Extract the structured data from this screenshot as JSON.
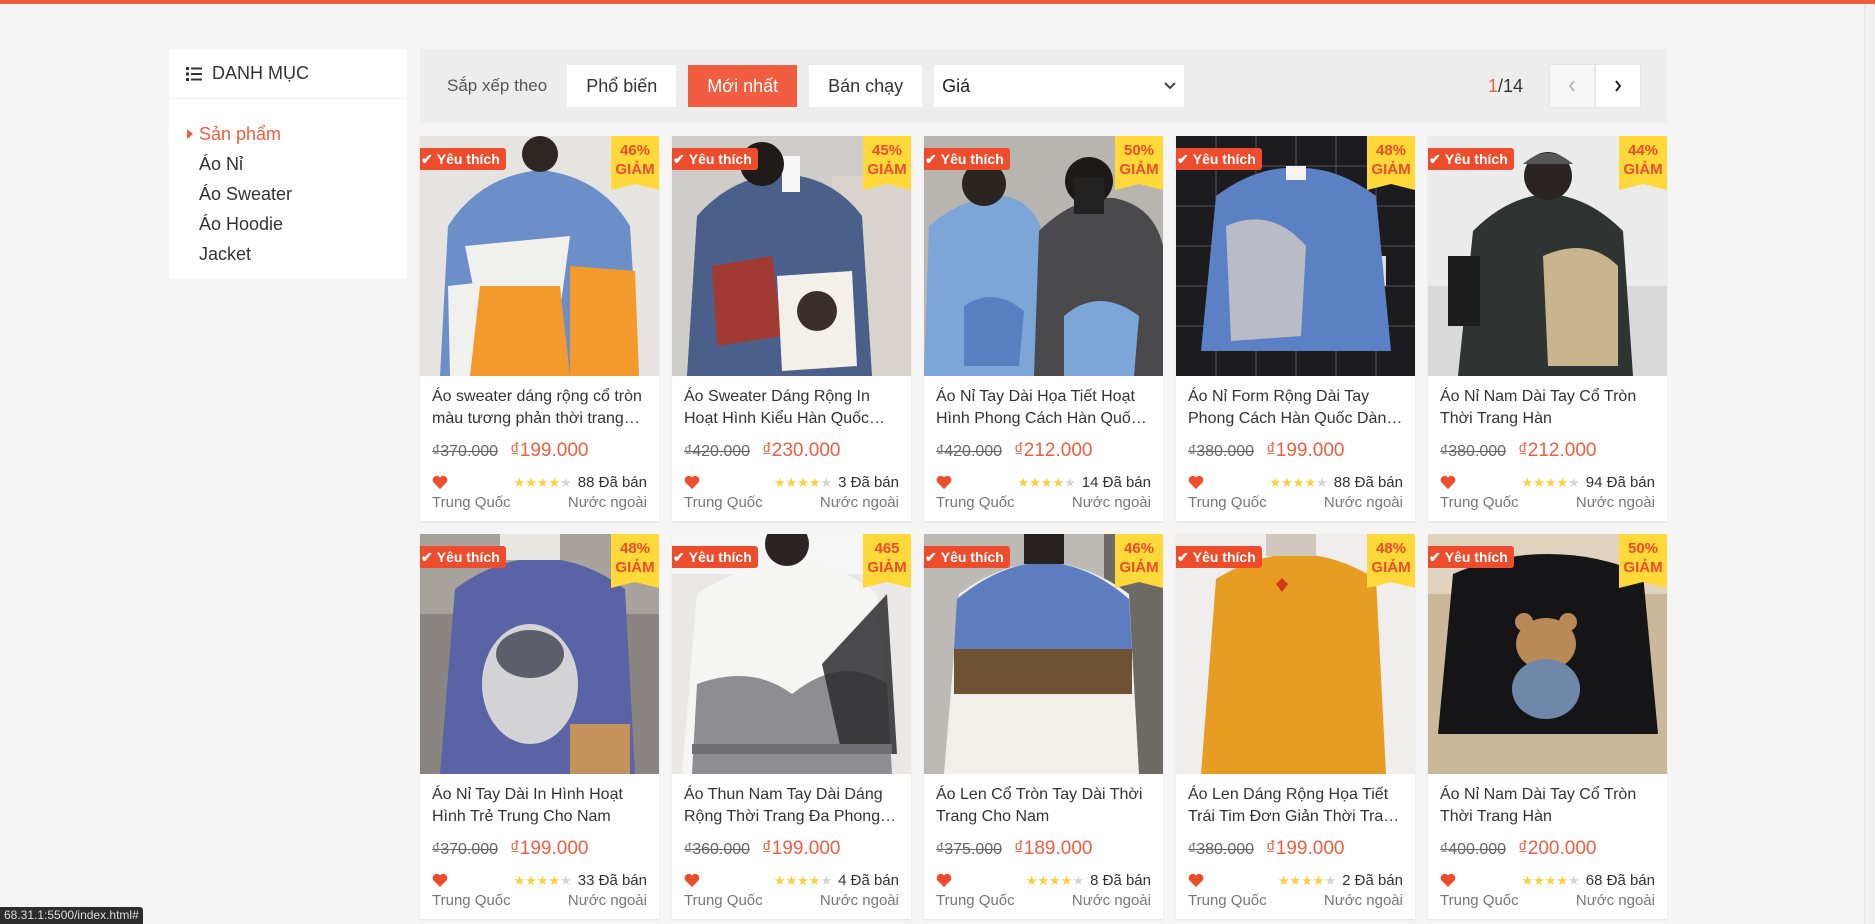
{
  "colors": {
    "accent": "#f05d40",
    "sale_bg": "#ffd839",
    "heart": "#ee4d2d",
    "star": "#ffce3d"
  },
  "category": {
    "icon": "list-icon",
    "title": "DANH MỤC",
    "items": [
      {
        "label": "Sản phẩm",
        "active": true
      },
      {
        "label": "Áo Nỉ",
        "active": false
      },
      {
        "label": "Áo Sweater",
        "active": false
      },
      {
        "label": "Áo Hoodie",
        "active": false
      },
      {
        "label": "Jacket",
        "active": false
      }
    ]
  },
  "sortbar": {
    "label": "Sắp xếp theo",
    "buttons": [
      {
        "label": "Phổ biến",
        "primary": false
      },
      {
        "label": "Mới nhất",
        "primary": true
      },
      {
        "label": "Bán chạy",
        "primary": false
      }
    ],
    "price_select": "Giá",
    "pager": {
      "current": "1",
      "total": "/14"
    }
  },
  "products": [
    {
      "name": "Áo sweater dáng rộng cổ tròn màu tương phản thời trang Hàn Quốc",
      "fav": "Yêu thích",
      "sale_pct": "46%",
      "sale_word": "GIẢM",
      "old_price": "₫370.000",
      "new_price": "₫199.000",
      "rating": 4,
      "sold": "88 Đã bán",
      "brand": "Trung Quốc",
      "origin": "Nước ngoài"
    },
    {
      "name": "Áo Sweater Dáng Rộng In Hoạt Hình Kiểu Hàn Quốc Cho Nam",
      "fav": "Yêu thích",
      "sale_pct": "45%",
      "sale_word": "GIẢM",
      "old_price": "₫420.000",
      "new_price": "₫230.000",
      "rating": 4,
      "sold": "3 Đã bán",
      "brand": "Trung Quốc",
      "origin": "Nước ngoài"
    },
    {
      "name": "Áo Nỉ Tay Dài Họa Tiết Hoạt Hình Phong Cách Hàn Quốc Cho Nam",
      "fav": "Yêu thích",
      "sale_pct": "50%",
      "sale_word": "GIẢM",
      "old_price": "₫420.000",
      "new_price": "₫212.000",
      "rating": 4,
      "sold": "14 Đã bán",
      "brand": "Trung Quốc",
      "origin": "Nước ngoài"
    },
    {
      "name": "Áo Nỉ Form Rộng Dài Tay Phong Cách Hàn Quốc Dành Cho Nam",
      "fav": "Yêu thích",
      "sale_pct": "48%",
      "sale_word": "GIẢM",
      "old_price": "₫380.000",
      "new_price": "₫199.000",
      "rating": 4,
      "sold": "88 Đã bán",
      "brand": "Trung Quốc",
      "origin": "Nước ngoài"
    },
    {
      "name": "Áo Nỉ Nam Dài Tay Cổ Tròn Thời Trang Hàn",
      "fav": "Yêu thích",
      "sale_pct": "44%",
      "sale_word": "GIẢM",
      "old_price": "₫380.000",
      "new_price": "₫212.000",
      "rating": 4,
      "sold": "94 Đã bán",
      "brand": "Trung Quốc",
      "origin": "Nước ngoài"
    },
    {
      "name": "Áo Nỉ Tay Dài In Hình Hoạt Hình Trẻ Trung Cho Nam",
      "fav": "Yêu thích",
      "sale_pct": "48%",
      "sale_word": "GIẢM",
      "old_price": "₫370.000",
      "new_price": "₫199.000",
      "rating": 4,
      "sold": "33 Đã bán",
      "brand": "Trung Quốc",
      "origin": "Nước ngoài"
    },
    {
      "name": "Áo Thun Nam Tay Dài Dáng Rộng Thời Trang Đa Phong Cách",
      "fav": "Yêu thích",
      "sale_pct": "465",
      "sale_word": "GIẢM",
      "old_price": "₫360.000",
      "new_price": "₫199.000",
      "rating": 4,
      "sold": "4 Đã bán",
      "brand": "Trung Quốc",
      "origin": "Nước ngoài"
    },
    {
      "name": "Áo Len Cổ Tròn Tay Dài Thời Trang Cho Nam",
      "fav": "Yêu thích",
      "sale_pct": "46%",
      "sale_word": "GIẢM",
      "old_price": "₫375.000",
      "new_price": "₫189.000",
      "rating": 4,
      "sold": "8 Đã bán",
      "brand": "Trung Quốc",
      "origin": "Nước ngoài"
    },
    {
      "name": "Áo Len Dáng Rộng Họa Tiết Trái Tim Đơn Giản Thời Trang Hàn",
      "fav": "Yêu thích",
      "sale_pct": "48%",
      "sale_word": "GIẢM",
      "old_price": "₫380.000",
      "new_price": "₫199.000",
      "rating": 4,
      "sold": "2 Đã bán",
      "brand": "Trung Quốc",
      "origin": "Nước ngoài"
    },
    {
      "name": "Áo Nỉ Nam Dài Tay Cổ Tròn Thời Trang Hàn",
      "fav": "Yêu thích",
      "sale_pct": "50%",
      "sale_word": "GIẢM",
      "old_price": "₫400.000",
      "new_price": "₫200.000",
      "rating": 4,
      "sold": "68 Đã bán",
      "brand": "Trung Quốc",
      "origin": "Nước ngoài"
    }
  ],
  "status_url": "68.31.1:5500/index.html#"
}
